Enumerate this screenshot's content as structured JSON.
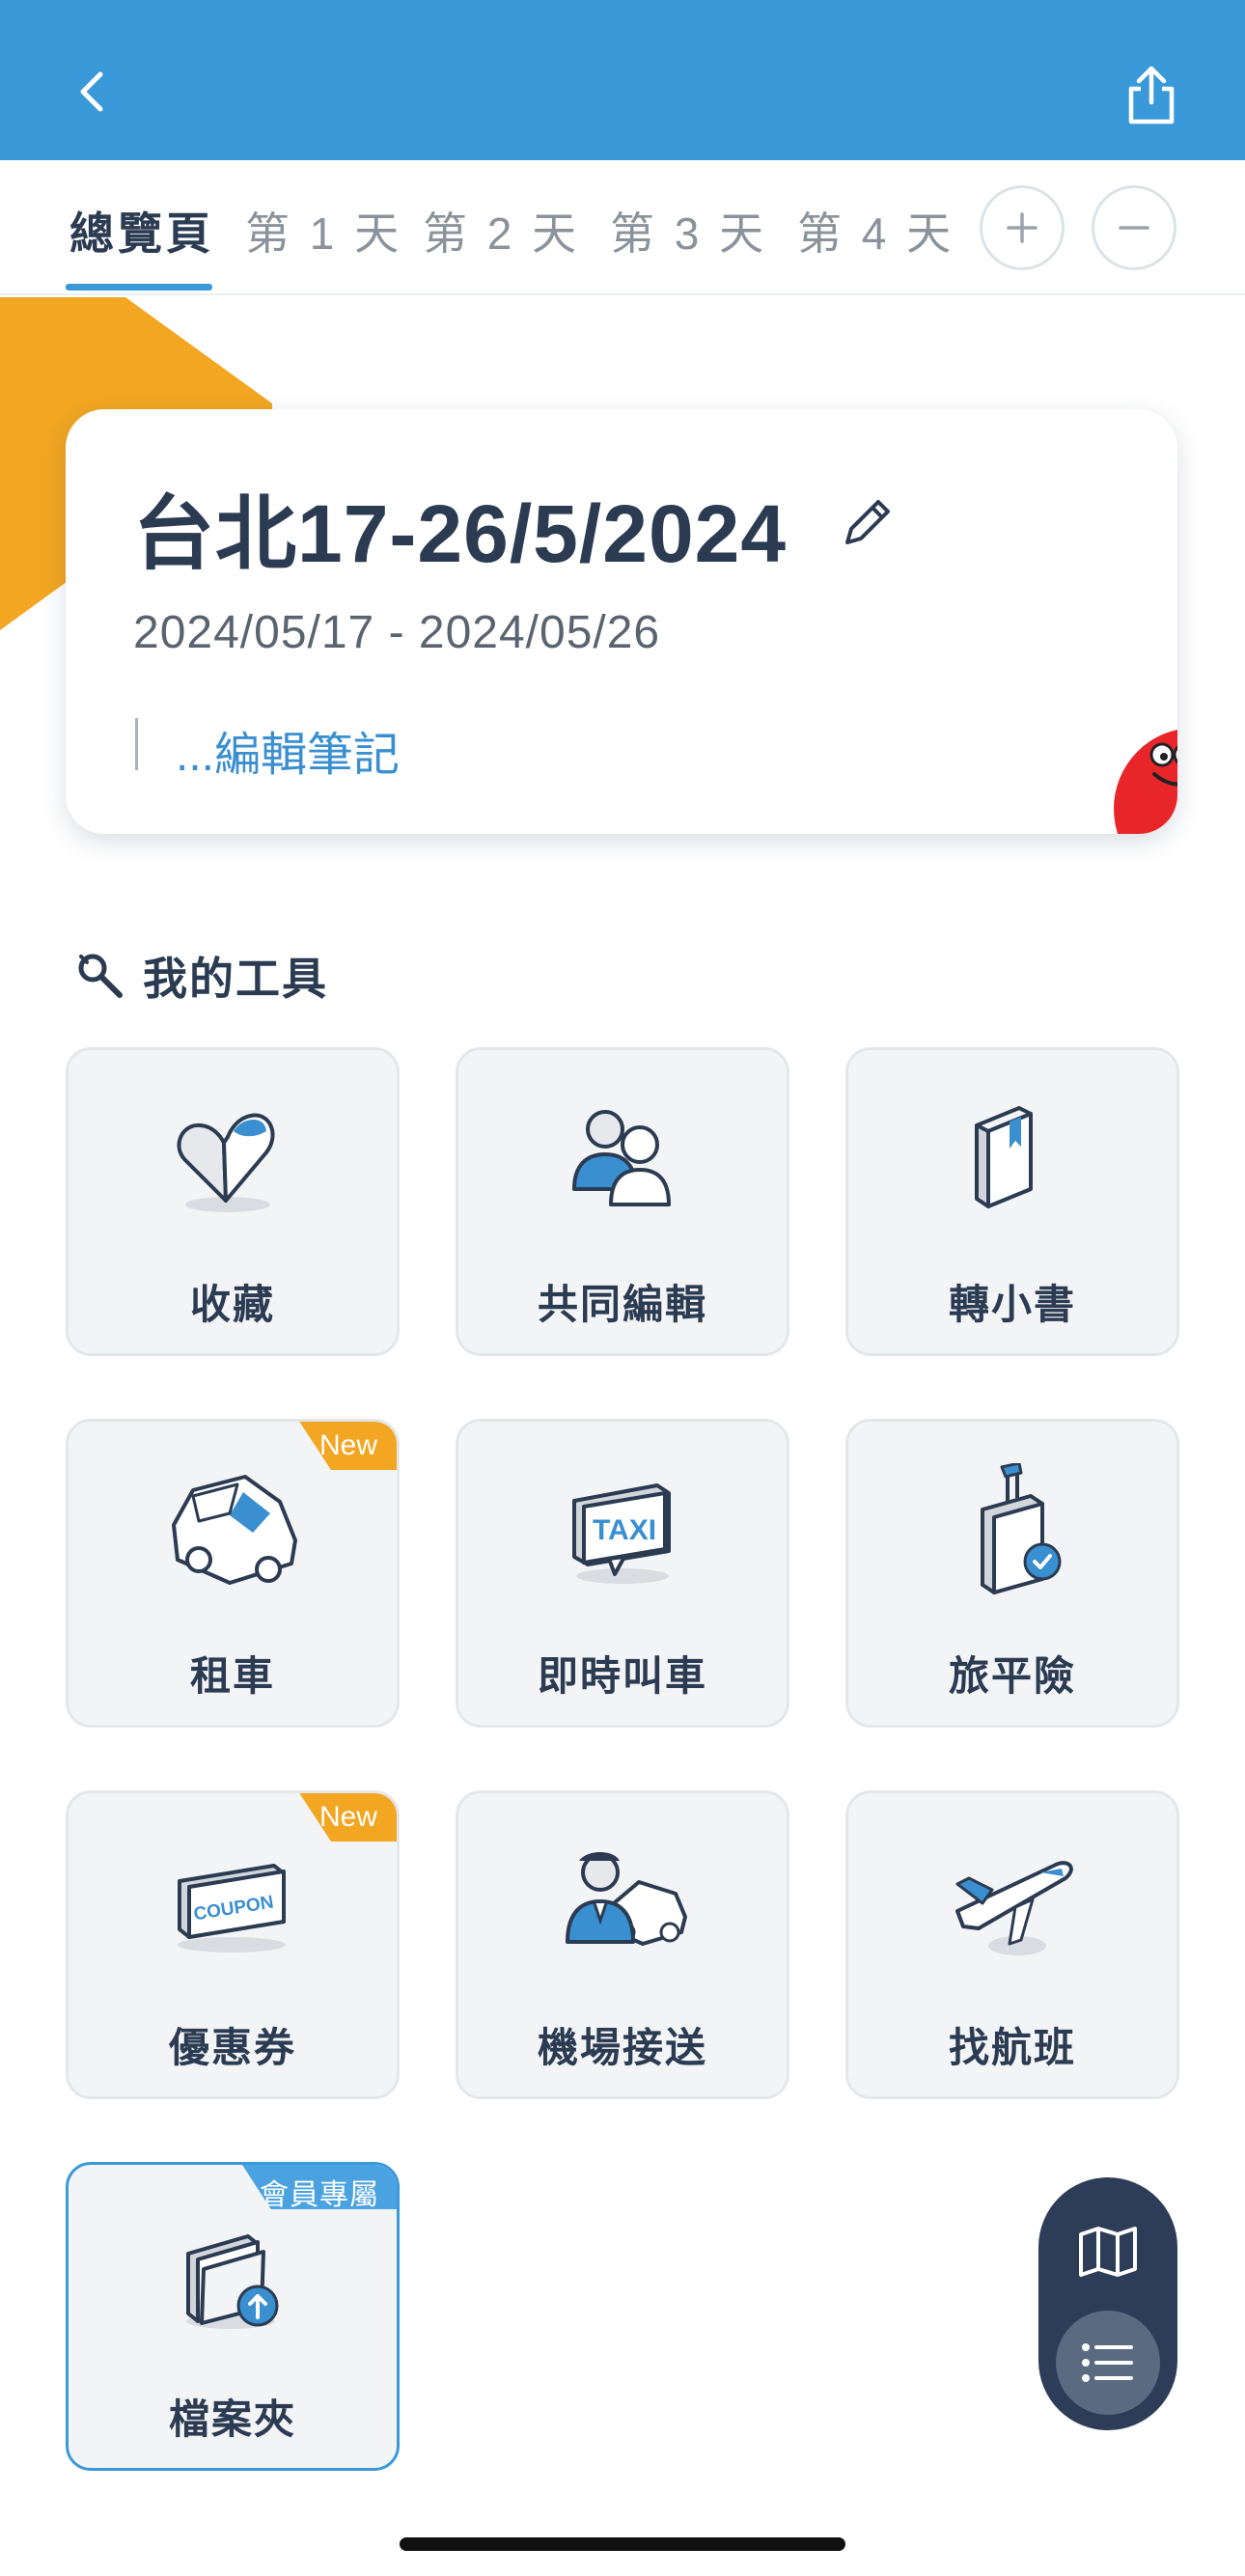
{
  "header": {
    "back_icon": "chevron-left-icon",
    "share_icon": "share-icon",
    "color": "#3a9ad9"
  },
  "tabs": {
    "items": [
      {
        "label": "總覽頁",
        "active": true
      },
      {
        "label": "第 1 天"
      },
      {
        "label": "第 2 天"
      },
      {
        "label": "第 3 天"
      },
      {
        "label": "第 4 天"
      }
    ],
    "add_icon": "plus-icon",
    "remove_icon": "minus-icon"
  },
  "trip": {
    "title": "台北17-26/5/2024",
    "dates": "2024/05/17 - 2024/05/26",
    "note_link": "...編輯筆記"
  },
  "tools_section": {
    "title": "我的工具",
    "icon": "wrench-search-icon",
    "items": [
      {
        "label": "收藏",
        "icon": "heart-icon"
      },
      {
        "label": "共同編輯",
        "icon": "people-icon"
      },
      {
        "label": "轉小書",
        "icon": "book-icon"
      },
      {
        "label": "租車",
        "icon": "car-icon",
        "badge": "New"
      },
      {
        "label": "即時叫車",
        "icon": "taxi-icon",
        "taxi_text": "TAXI"
      },
      {
        "label": "旅平險",
        "icon": "luggage-icon"
      },
      {
        "label": "優惠券",
        "icon": "coupon-icon",
        "badge": "New",
        "coupon_text": "COUPON"
      },
      {
        "label": "機場接送",
        "icon": "driver-car-icon"
      },
      {
        "label": "找航班",
        "icon": "airplane-icon"
      },
      {
        "label": "檔案夾",
        "icon": "folder-upload-icon",
        "badge": "會員專屬"
      }
    ]
  },
  "fab": {
    "map_icon": "map-icon",
    "list_icon": "list-icon"
  },
  "colors": {
    "accent": "#3a9ad9",
    "orange": "#f2a622",
    "navy": "#2d3d57",
    "mascot_red": "#e8262a"
  }
}
